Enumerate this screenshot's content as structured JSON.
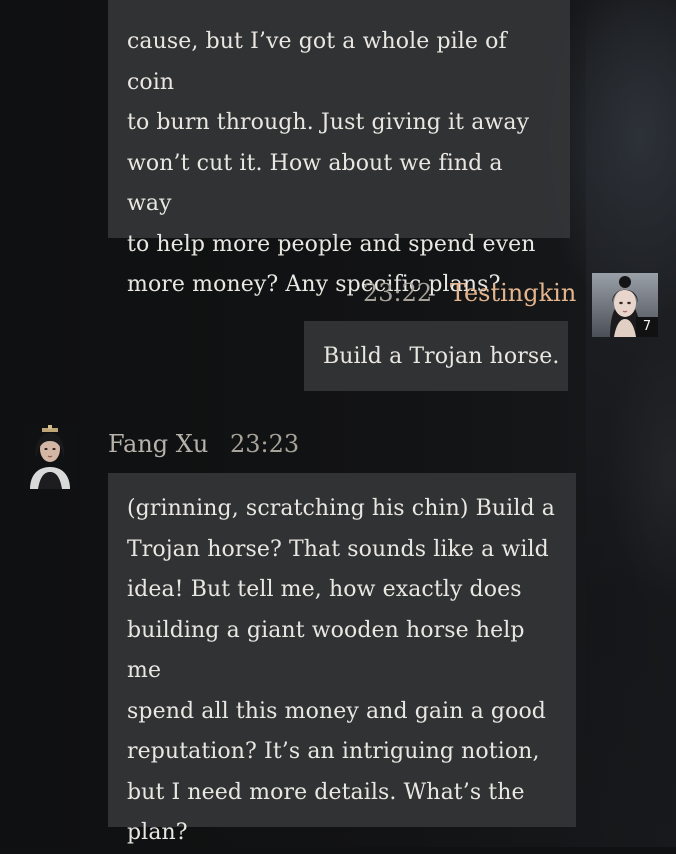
{
  "messages": [
    {
      "id": "npc-previous",
      "lines": [
        "cause, but I’ve got a whole pile of coin",
        "to burn through. Just giving it away",
        "won’t cut it. How about we find a way",
        "to help more people and spend even",
        "more money? Any specific plans?"
      ]
    },
    {
      "id": "user-message",
      "time": "23:22",
      "name": "Testingkin",
      "avatar_badge": "7",
      "lines": [
        "Build a Trojan horse."
      ]
    },
    {
      "id": "npc-reply",
      "time": "23:23",
      "name": "Fang Xu",
      "lines": [
        "(grinning, scratching his chin) Build a",
        "Trojan horse? That sounds like a wild",
        "idea! But tell me, how exactly does",
        "building a giant wooden horse help me",
        "spend all this money and gain a good",
        "reputation? It’s an intriguing notion,",
        "but I need more details. What’s the",
        "plan?"
      ]
    }
  ],
  "colors": {
    "bubble": "#343537",
    "text": "#e9e7e2",
    "user_name": "#e3b48d",
    "npc_name": "#b7b2aa",
    "time": "#a7a29a"
  }
}
